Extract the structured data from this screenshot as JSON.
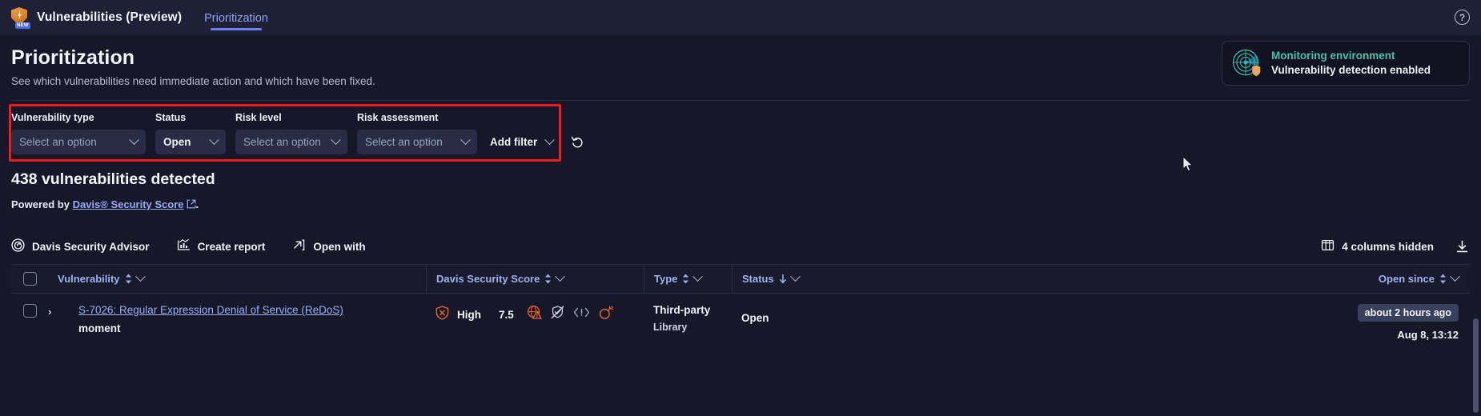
{
  "topnav": {
    "app_icon": "shield-bolt-icon",
    "new_badge": "NEW",
    "app_title": "Vulnerabilities (Preview)",
    "tab": "Prioritization",
    "help_icon": "?"
  },
  "header": {
    "title": "Prioritization",
    "subtitle": "See which vulnerabilities need immediate action and which have been fixed.",
    "env_card": {
      "icon": "radar-shield-icon",
      "line1": "Monitoring environment",
      "line2": "Vulnerability detection enabled",
      "accent": "#4fbfa8"
    }
  },
  "filters": {
    "highlight_color": "#f01c1c",
    "items": [
      {
        "label": "Vulnerability type",
        "value": "Select an option",
        "is_placeholder": true
      },
      {
        "label": "Status",
        "value": "Open",
        "is_placeholder": false
      },
      {
        "label": "Risk level",
        "value": "Select an option",
        "is_placeholder": true
      },
      {
        "label": "Risk assessment",
        "value": "Select an option",
        "is_placeholder": true
      }
    ],
    "add_filter": "Add filter",
    "reset_icon": "reset-arrow-icon"
  },
  "summary": {
    "count_text": "438 vulnerabilities detected",
    "powered_prefix": "Powered by ",
    "powered_link": "Davis® Security Score",
    "powered_suffix": ".",
    "external_icon": "external-link-icon"
  },
  "toolbar": {
    "advisor": "Davis Security Advisor",
    "advisor_icon": "davis-swirl-icon",
    "create_report": "Create report",
    "create_report_icon": "chart-report-icon",
    "open_with": "Open with",
    "open_with_icon": "open-external-icon",
    "columns_hidden": "4 columns hidden",
    "columns_icon": "columns-table-icon",
    "download_icon": "download-icon"
  },
  "table": {
    "columns": [
      {
        "label": "Vulnerability",
        "sort": "both"
      },
      {
        "label": "Davis Security Score",
        "sort": "both"
      },
      {
        "label": "Type",
        "sort": "both"
      },
      {
        "label": "Status",
        "sort": "desc"
      },
      {
        "label": "Open since",
        "sort": "both"
      }
    ],
    "rows": [
      {
        "vulnerability_id_title": "S-7026: Regular Expression Denial of Service (ReDoS)",
        "component": "moment",
        "risk_level": "High",
        "risk_icon": "shield-x-icon",
        "risk_color": "#e8622c",
        "score": "7.5",
        "attribute_icons": [
          {
            "name": "internet-exposure-icon",
            "state": "active",
            "color": "#e8622c"
          },
          {
            "name": "data-assets-crossed-icon",
            "state": "inactive",
            "color": "#c9cee0"
          },
          {
            "name": "public-exploit-icon",
            "state": "inactive",
            "color": "#9aa2be"
          },
          {
            "name": "vulnerable-function-icon",
            "state": "active",
            "color": "#e8622c"
          }
        ],
        "type_main": "Third-party",
        "type_sub": "Library",
        "status": "Open",
        "open_since_badge": "about 2 hours ago",
        "open_since_date": "Aug 8, 13:12"
      }
    ]
  }
}
